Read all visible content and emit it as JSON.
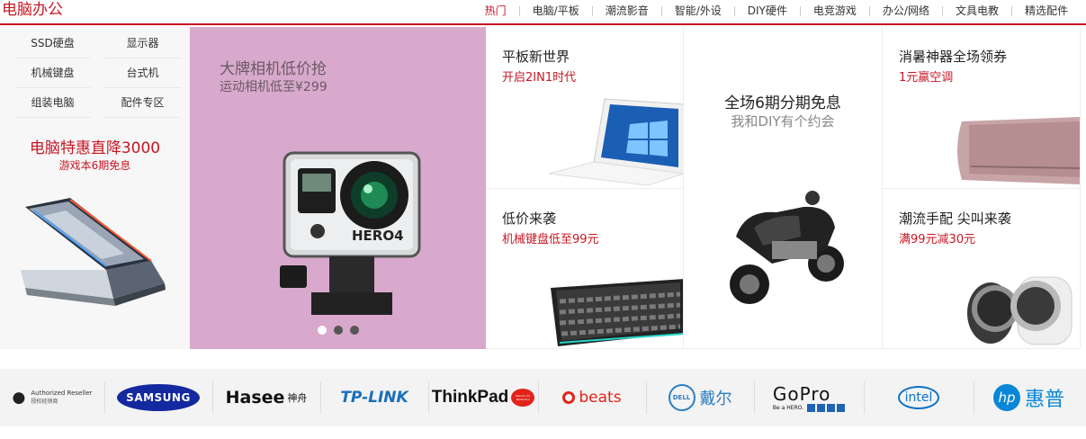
{
  "header": {
    "title": "电脑办公",
    "nav": [
      "热门",
      "电脑/平板",
      "潮流影音",
      "智能/外设",
      "DIY硬件",
      "电竞游戏",
      "办公/网络",
      "文具电教",
      "精选配件"
    ],
    "active_index": 0
  },
  "left": {
    "links": [
      "SSD硬盘",
      "显示器",
      "机械键盘",
      "台式机",
      "组装电脑",
      "配件专区"
    ],
    "promo_title": "电脑特惠直降3000",
    "promo_sub": "游戏本6期免息"
  },
  "carousel": {
    "title": "大牌相机低价抢",
    "subtitle": "运动相机低至¥299",
    "camera_label": "HERO4",
    "dots": 3,
    "active_dot": 0
  },
  "tiles": {
    "tablet": {
      "title": "平板新世界",
      "sub": "开启2IN1时代"
    },
    "center": {
      "title": "全场6期分期免息",
      "sub": "我和DIY有个约会"
    },
    "aircon": {
      "title": "消暑神器全场领券",
      "sub": "1元赢空调"
    },
    "keyboard": {
      "title": "低价来袭",
      "sub": "机械键盘低至99元"
    },
    "watch": {
      "title": "潮流手配 尖叫来袭",
      "sub": "满99元减30元"
    }
  },
  "brands": [
    {
      "name": "apple",
      "text": "Authorized Reseller",
      "sub": "授权经销商"
    },
    {
      "name": "samsung",
      "text": "SAMSUNG"
    },
    {
      "name": "hasee",
      "text": "Hasee",
      "cn": "神舟"
    },
    {
      "name": "tplink",
      "text": "TP-LINK"
    },
    {
      "name": "thinkpad",
      "text": "ThinkPad",
      "badge": "Passion for Perfection"
    },
    {
      "name": "beats",
      "text": "beats"
    },
    {
      "name": "dell",
      "text": "DELL",
      "cn": "戴尔"
    },
    {
      "name": "gopro",
      "text": "GoPro",
      "sub": "Be a HERO."
    },
    {
      "name": "intel",
      "text": "intel"
    },
    {
      "name": "hp",
      "text": "hp",
      "cn": "惠普"
    }
  ],
  "colors": {
    "accent": "#c81623",
    "carousel_bg": "#d8a9cc"
  }
}
